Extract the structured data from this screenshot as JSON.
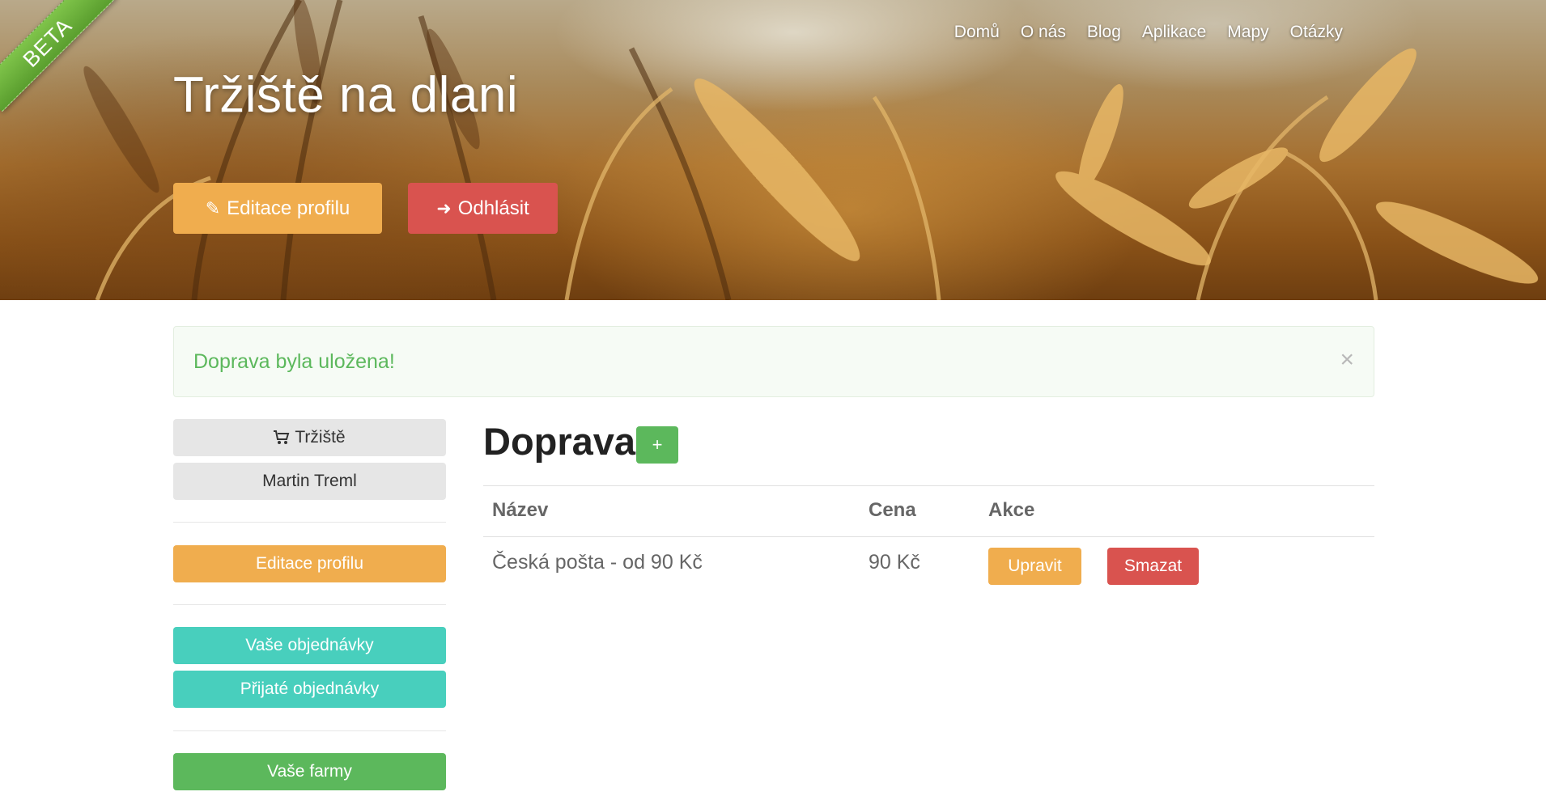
{
  "beta": "BETA",
  "nav": [
    "Domů",
    "O nás",
    "Blog",
    "Aplikace",
    "Mapy",
    "Otázky"
  ],
  "site_title": "Tržiště na dlani",
  "hero_buttons": {
    "edit": "Editace profilu",
    "logout": "Odhlásit"
  },
  "alert": {
    "message": "Doprava byla uložena!",
    "close": "×"
  },
  "sidebar": {
    "market": "Tržiště",
    "user": "Martin Treml",
    "edit_profile": "Editace profilu",
    "your_orders": "Vaše objednávky",
    "received_orders": "Přijaté objednávky",
    "your_farms": "Vaše farmy"
  },
  "main": {
    "heading": "Doprava",
    "add": "+",
    "columns": [
      "Název",
      "Cena",
      "Akce"
    ],
    "rows": [
      {
        "name": "Česká pošta - od 90 Kč",
        "price": "90 Kč",
        "edit": "Upravit",
        "delete": "Smazat"
      }
    ]
  },
  "colors": {
    "warning": "#f0ad4e",
    "danger": "#d9534f",
    "success": "#5cb85c",
    "info": "#48cfbd"
  }
}
